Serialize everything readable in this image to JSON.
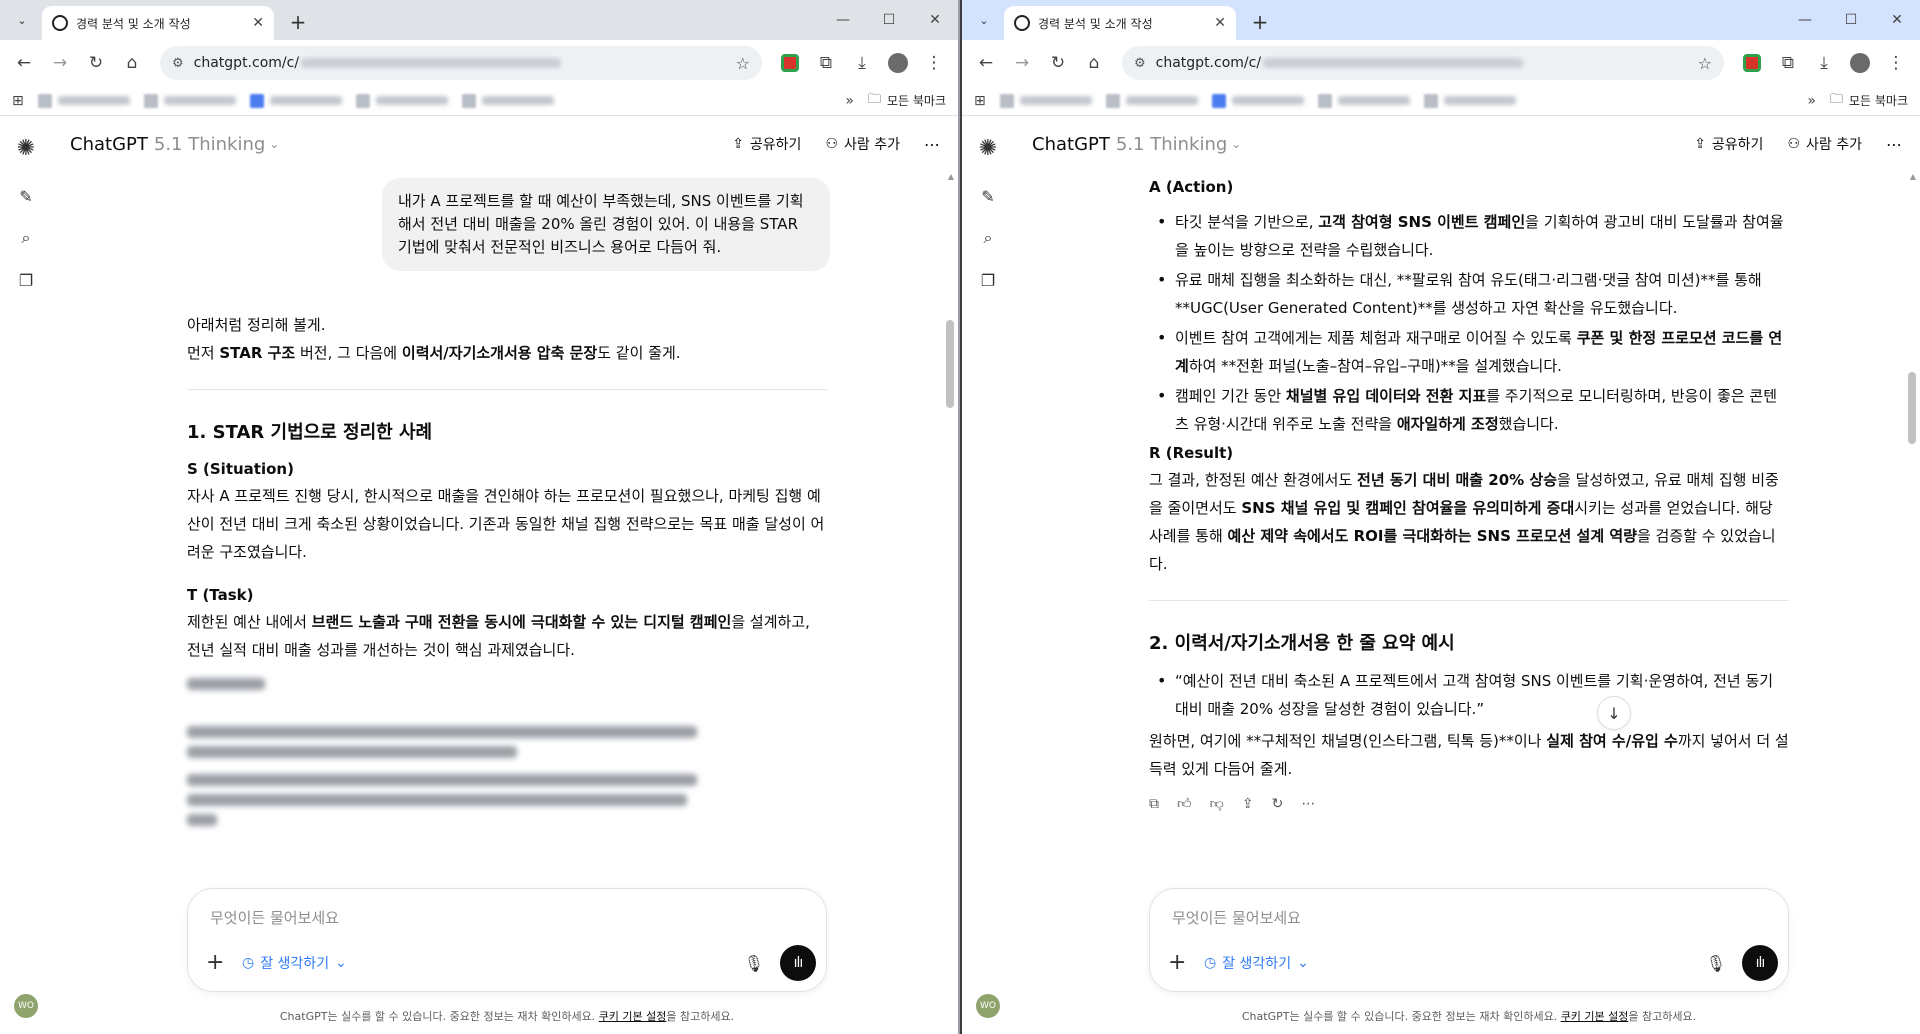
{
  "browser": {
    "tab_title": "경력 분석 및 소개 작성",
    "url_prefix": "chatgpt.com/c/",
    "bookmarks_folder": "모든 북마크",
    "tab_menu": "⌄",
    "new_tab": "+",
    "close_tab": "✕",
    "minimize": "—",
    "maximize": "☐",
    "close_window": "✕"
  },
  "app": {
    "model_name": "ChatGPT",
    "model_version": "5.1 Thinking",
    "share_label": "공유하기",
    "add_people_label": "사람 추가",
    "avatar_initials": "WO",
    "composer_placeholder": "무엇이든 물어보세요",
    "think_label": "잘 생각하기",
    "footer_text": "ChatGPT는 실수를 할 수 있습니다. 중요한 정보는 재차 확인하세요.",
    "footer_link": "쿠키 기본 설정",
    "footer_suffix": "을 참고하세요."
  },
  "left_pane": {
    "user_message": "내가 A 프로젝트를 할 때 예산이 부족했는데, SNS 이벤트를 기획해서 전년 대비 매출을 20% 올린 경험이 있어. 이 내용을 STAR 기법에 맞춰서 전문적인 비즈니스 용어로 다듬어 줘.",
    "intro_1": "아래처럼 정리해 볼게.",
    "intro_2_a": "먼저 ",
    "intro_2_b": "STAR 구조",
    "intro_2_c": " 버전, 그 다음에 ",
    "intro_2_d": "이력서/자기소개서용 압축 문장",
    "intro_2_e": "도 같이 줄게.",
    "section1_title": "1. STAR 기법으로 정리한 사례",
    "s_title": "S (Situation)",
    "s_text": "자사 A 프로젝트 진행 당시, 한시적으로 매출을 견인해야 하는 프로모션이 필요했으나, 마케팅 집행 예산이 전년 대비 크게 축소된 상황이었습니다. 기존과 동일한 채널 집행 전략으로는 목표 매출 달성이 어려운 구조였습니다.",
    "t_title": "T (Task)",
    "t_text_a": "제한된 예산 내에서 ",
    "t_text_b": "브랜드 노출과 구매 전환을 동시에 극대화할 수 있는 디지털 캠페인",
    "t_text_c": "을 설계하고, 전년 실적 대비 매출 성과를 개선하는 것이 핵심 과제였습니다."
  },
  "right_pane": {
    "a_title": "A (Action)",
    "a1_a": "타깃 분석을 기반으로, ",
    "a1_b": "고객 참여형 SNS 이벤트 캠페인",
    "a1_c": "을 기획하여 광고비 대비 도달률과 참여율을 높이는 방향으로 전략을 수립했습니다.",
    "a2": "유료 매체 집행을 최소화하는 대신, **팔로워 참여 유도(태그·리그램·댓글 참여 미션)**를 통해 **UGC(User Generated Content)**를 생성하고 자연 확산을 유도했습니다.",
    "a3_a": "이벤트 참여 고객에게는 제품 체험과 재구매로 이어질 수 있도록 ",
    "a3_b": "쿠폰 및 한정 프로모션 코드를 연계",
    "a3_c": "하여 **전환 퍼널(노출–참여–유입–구매)**을 설계했습니다.",
    "a4_a": "캠페인 기간 동안 ",
    "a4_b": "채널별 유입 데이터와 전환 지표",
    "a4_c": "를 주기적으로 모니터링하며, 반응이 좋은 콘텐츠 유형·시간대 위주로 노출 전략을 ",
    "a4_d": "애자일하게 조정",
    "a4_e": "했습니다.",
    "r_title": "R (Result)",
    "r_a": "그 결과, 한정된 예산 환경에서도 ",
    "r_b": "전년 동기 대비 매출 20% 상승",
    "r_c": "을 달성하였고, 유료 매체 집행 비중을 줄이면서도 ",
    "r_d": "SNS 채널 유입 및 캠페인 참여율을 유의미하게 증대",
    "r_e": "시키는 성과를 얻었습니다. 해당 사례를 통해 ",
    "r_f": "예산 제약 속에서도 ROI를 극대화하는 SNS 프로모션 설계 역량",
    "r_g": "을 검증할 수 있었습니다.",
    "section2_title": "2. 이력서/자기소개서용 한 줄 요약 예시",
    "summary": "“예산이 전년 대비 축소된 A 프로젝트에서 고객 참여형 SNS 이벤트를 기획·운영하여, 전년 동기 대비 매출 20% 성장을 달성한 경험이 있습니다.”",
    "outro_a": "원하면, 여기에 **구체적인 채널명(인스타그램, 틱톡 등)**이나 ",
    "outro_b": "실제 참여 수/유입 수",
    "outro_c": "까지 넣어서 더 설득력 있게 다듬어 줄게."
  }
}
